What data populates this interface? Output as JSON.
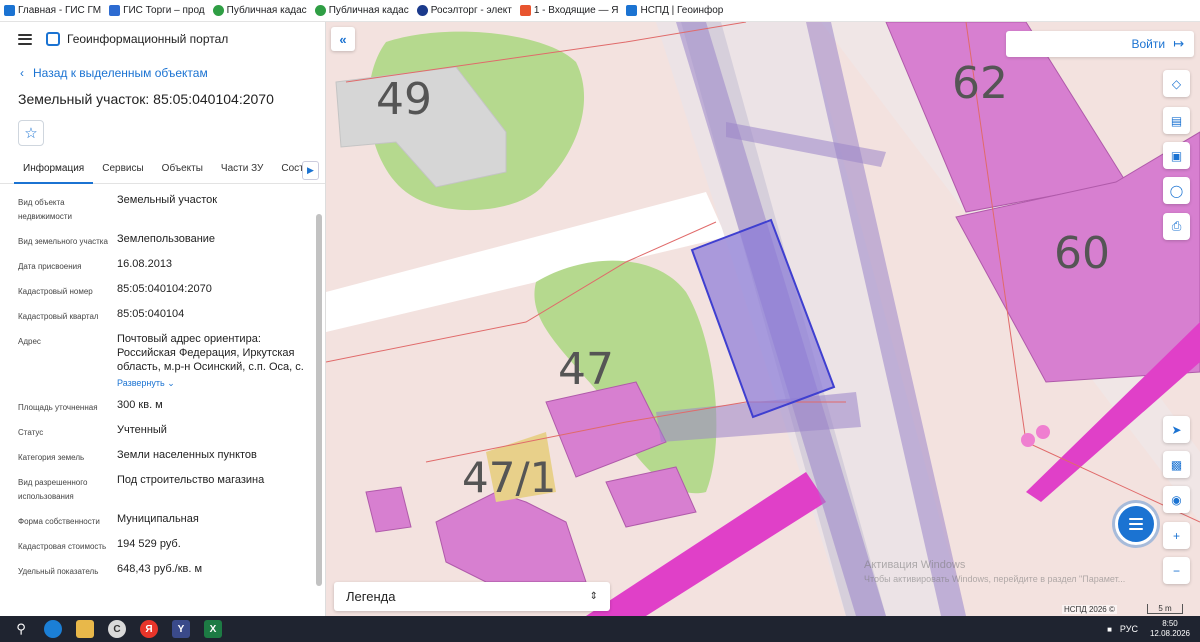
{
  "bookmarks": [
    {
      "label": "Главная - ГИС ГМ",
      "color": "#1b73d2"
    },
    {
      "label": "ГИС Торги – прод",
      "color": "#2d6bd1"
    },
    {
      "label": "Публичная кадас",
      "color": "#2f9e44"
    },
    {
      "label": "Публичная кадас",
      "color": "#2f9e44"
    },
    {
      "label": "Росэлторг - элект",
      "color": "#1b3a8c"
    },
    {
      "label": "1 - Входящие — Я",
      "color": "#e8542f"
    },
    {
      "label": "НСПД | Геоинфор",
      "color": "#1b73d2"
    }
  ],
  "header": {
    "title": "Геоинформационный портал"
  },
  "back_link": "Назад к выделенным объектам",
  "parcel_title": "Земельный участок: 85:05:040104:2070",
  "tabs": [
    {
      "label": "Информация",
      "active": true
    },
    {
      "label": "Сервисы",
      "active": false
    },
    {
      "label": "Объекты",
      "active": false
    },
    {
      "label": "Части ЗУ",
      "active": false
    },
    {
      "label": "Состав",
      "active": false
    }
  ],
  "properties": [
    {
      "label": "Вид объекта недвижимости",
      "value": "Земельный участок"
    },
    {
      "label": "Вид земельного участка",
      "value": "Землепользование"
    },
    {
      "label": "Дата присвоения",
      "value": "16.08.2013"
    },
    {
      "label": "Кадастровый номер",
      "value": "85:05:040104:2070"
    },
    {
      "label": "Кадастровый квартал",
      "value": "85:05:040104"
    },
    {
      "label": "Адрес",
      "value": "Почтовый адрес ориентира: Российская Федерация, Иркутская область, м.р-н Осинский, с.п. Оса, с.",
      "more": "Развернуть"
    },
    {
      "label": "Площадь уточненная",
      "value": "300 кв. м"
    },
    {
      "label": "Статус",
      "value": "Учтенный"
    },
    {
      "label": "Категория земель",
      "value": "Земли населенных пунктов"
    },
    {
      "label": "Вид разрешенного использования",
      "value": "Под строительство магазина"
    },
    {
      "label": "Форма собственности",
      "value": "Муниципальная"
    },
    {
      "label": "Кадастровая стоимость",
      "value": "194 529 руб."
    },
    {
      "label": "Удельный показатель",
      "value": "648,43 руб./кв. м"
    }
  ],
  "map": {
    "login_label": "Войти",
    "legend_label": "Легенда",
    "building_numbers": [
      "49",
      "62",
      "60",
      "47",
      "47/1"
    ],
    "watermark_line1": "Активация Windows",
    "watermark_line2": "Чтобы активировать Windows, перейдите в раздел \"Парамет...",
    "copyright": "НСПД 2026 ©",
    "scale": "5 m",
    "selected_color": "#3f3fd0",
    "building_color": "#d77fd0"
  },
  "taskbar": {
    "lang": "РУС",
    "time": "8:50",
    "date": "12.08.2026"
  }
}
